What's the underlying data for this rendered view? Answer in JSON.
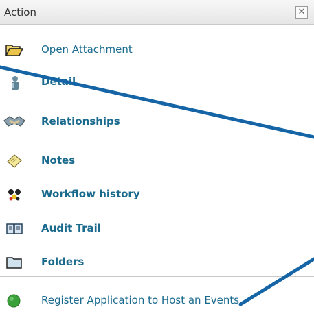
{
  "panel": {
    "title": "Action",
    "close_glyph": "✕"
  },
  "items": [
    {
      "label": "Open Attachment",
      "icon": "folder-open-icon"
    },
    {
      "label": "Detail",
      "icon": "detail-icon"
    },
    {
      "label": "Relationships",
      "icon": "relationships-icon"
    },
    {
      "label": "Notes",
      "icon": "note-icon"
    },
    {
      "label": "Workflow history",
      "icon": "workflow-icon"
    },
    {
      "label": "Audit Trail",
      "icon": "book-icon"
    },
    {
      "label": "Folders",
      "icon": "folder-icon"
    },
    {
      "label": "Register Application to Host an Events",
      "icon": "green-circle-icon"
    }
  ],
  "colors": {
    "link": "#1a6a8e",
    "annotation": "#1565a6",
    "status_green": "#3aa03a"
  }
}
